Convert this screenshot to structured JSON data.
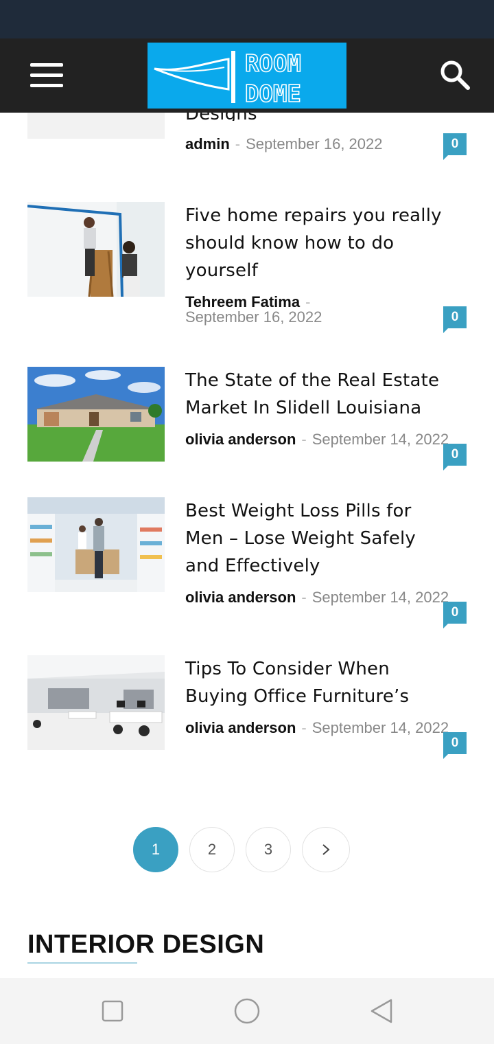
{
  "logo": {
    "text_line1": "ROOM",
    "text_line2": "DOME"
  },
  "header": {
    "menu_icon": "hamburger-icon",
    "search_icon": "search-icon"
  },
  "partial_post": {
    "title_fragment": "Designs",
    "author": "admin",
    "date": "September 16, 2022",
    "comments": "0"
  },
  "posts": [
    {
      "title_lines": [
        "Five home repairs you really",
        "should know how to do",
        "yourself"
      ],
      "author": "Tehreem Fatima",
      "date": "September 16, 2022",
      "comments": "0",
      "thumb": "wall-painting-photo"
    },
    {
      "title_lines": [
        "The State of the Real Estate",
        "Market In Slidell Louisiana"
      ],
      "author": "olivia anderson",
      "date": "September 14, 2022",
      "comments": "0",
      "thumb": "house-photo"
    },
    {
      "title_lines": [
        "Best Weight Loss Pills for",
        "Men – Lose Weight Safely",
        "and Effectively"
      ],
      "author": "olivia anderson",
      "date": "September 14, 2022",
      "comments": "0",
      "thumb": "pharmacy-photo"
    },
    {
      "title_lines": [
        "Tips To Consider When",
        "Buying Office Furniture’s"
      ],
      "author": "olivia anderson",
      "date": "September 14, 2022",
      "comments": "0",
      "thumb": "office-photo"
    }
  ],
  "meta_separator": "-",
  "pagination": {
    "pages": [
      "1",
      "2",
      "3"
    ],
    "current": "1",
    "next_icon": "chevron-right-icon"
  },
  "section": {
    "title": "INTERIOR DESIGN"
  },
  "nav_bar": {
    "recent_icon": "square-icon",
    "home_icon": "circle-icon",
    "back_icon": "triangle-back-icon"
  },
  "colors": {
    "accent": "#3aa0c2",
    "header_bg": "#222222",
    "status_bg": "#1f2b3a",
    "logo_bg": "#0aa9ec"
  }
}
